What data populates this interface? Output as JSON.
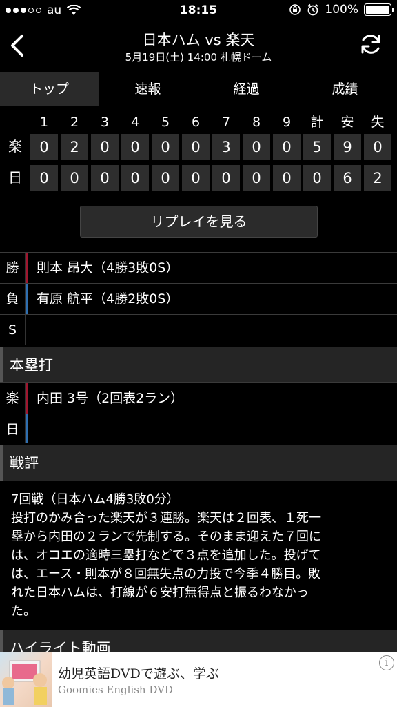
{
  "status": {
    "carrier": "au",
    "time": "18:15",
    "battery": "100%"
  },
  "header": {
    "title": "日本ハム vs 楽天",
    "subtitle": "5月19日(土) 14:00 札幌ドーム"
  },
  "tabs": [
    {
      "label": "トップ",
      "active": true
    },
    {
      "label": "速報",
      "active": false
    },
    {
      "label": "経過",
      "active": false
    },
    {
      "label": "成績",
      "active": false
    }
  ],
  "scoreboard": {
    "headers": [
      "1",
      "2",
      "3",
      "4",
      "5",
      "6",
      "7",
      "8",
      "9",
      "計",
      "安",
      "失"
    ],
    "rows": [
      {
        "team": "楽",
        "values": [
          "0",
          "2",
          "0",
          "0",
          "0",
          "0",
          "3",
          "0",
          "0",
          "5",
          "9",
          "0"
        ]
      },
      {
        "team": "日",
        "values": [
          "0",
          "0",
          "0",
          "0",
          "0",
          "0",
          "0",
          "0",
          "0",
          "0",
          "6",
          "2"
        ]
      }
    ]
  },
  "replay_label": "リプレイを見る",
  "pitchers": [
    {
      "label": "勝",
      "text": "則本 昂大（4勝3敗0S）",
      "color": "#a0162f"
    },
    {
      "label": "負",
      "text": "有原 航平（4勝2敗0S）",
      "color": "#2f6fb0"
    },
    {
      "label": "S",
      "text": "",
      "color": ""
    }
  ],
  "homeruns": {
    "title": "本塁打",
    "rows": [
      {
        "label": "楽",
        "text": "内田 3号（2回表2ラン）",
        "color": "#a0162f"
      },
      {
        "label": "日",
        "text": "",
        "color": "#2f6fb0"
      }
    ]
  },
  "review": {
    "title": "戦評",
    "lines": [
      "7回戦（日本ハム4勝3敗0分）",
      "投打のかみ合った楽天が３連勝。楽天は２回表、１死一",
      "塁から内田の２ランで先制する。そのまま迎えた７回に",
      "は、オコエの適時三塁打などで３点を追加した。投げて",
      "は、エース・則本が８回無失点の力投で今季４勝目。敗",
      "れた日本ハムは、打線が６安打無得点と振るわなかっ",
      "た。"
    ]
  },
  "highlight_title": "ハイライト動画",
  "ad": {
    "title": "幼児英語DVDで遊ぶ、学ぶ",
    "subtitle": "Goomies English DVD",
    "info": "i"
  }
}
